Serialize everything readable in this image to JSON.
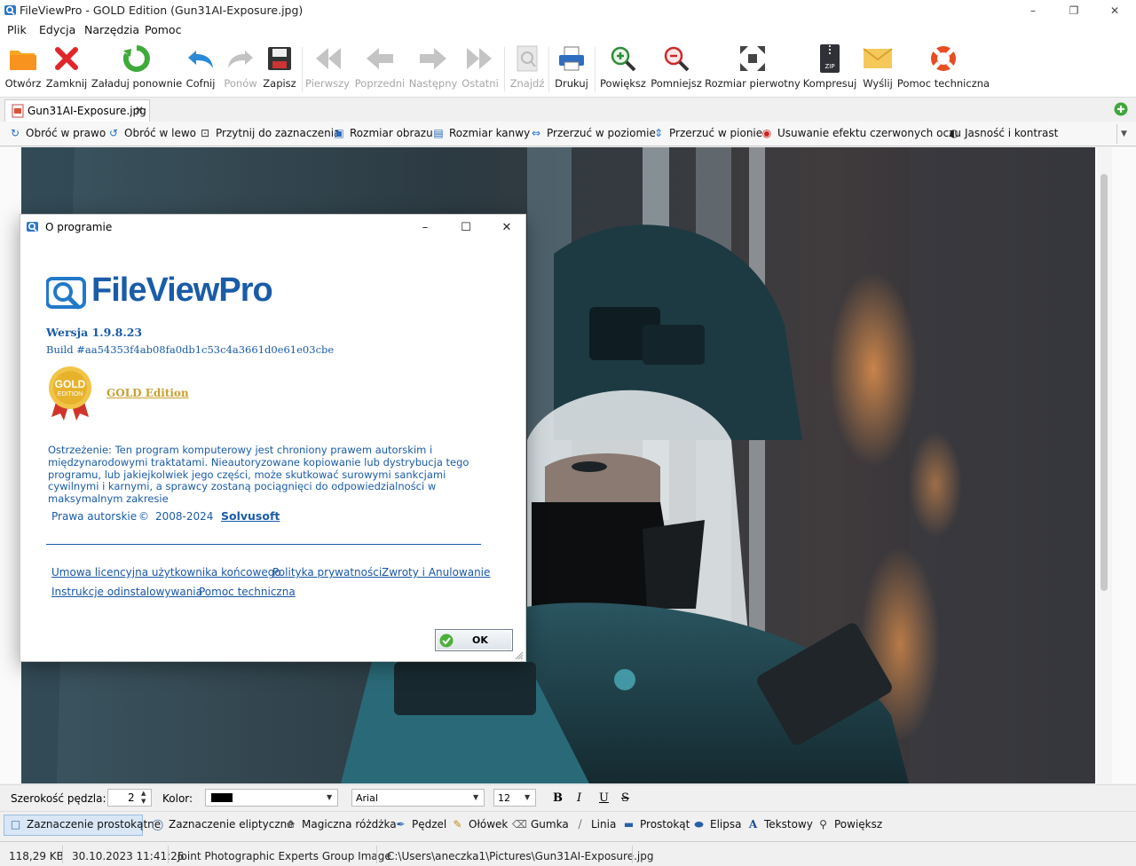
{
  "window": {
    "title": "FileViewPro - GOLD Edition (Gun31AI-Exposure.jpg)"
  },
  "menu": [
    "Plik",
    "Edycja",
    "Narzędzia",
    "Pomoc"
  ],
  "toolbar": [
    {
      "label": "Otwórz",
      "icon": "folder-open-icon",
      "enabled": true
    },
    {
      "label": "Zamknij",
      "icon": "close-x-icon",
      "enabled": true
    },
    {
      "label": "Załaduj ponownie",
      "icon": "reload-icon",
      "enabled": true
    },
    {
      "label": "Cofnij",
      "icon": "undo-icon",
      "enabled": true
    },
    {
      "label": "Ponów",
      "icon": "redo-icon",
      "enabled": false
    },
    {
      "label": "Zapisz",
      "icon": "save-icon",
      "enabled": true
    },
    {
      "label": "Pierwszy",
      "icon": "first-icon",
      "enabled": false
    },
    {
      "label": "Poprzedni",
      "icon": "previous-icon",
      "enabled": false
    },
    {
      "label": "Następny",
      "icon": "next-icon",
      "enabled": false
    },
    {
      "label": "Ostatni",
      "icon": "last-icon",
      "enabled": false
    },
    {
      "label": "Znajdź",
      "icon": "find-icon",
      "enabled": false
    },
    {
      "label": "Drukuj",
      "icon": "print-icon",
      "enabled": true
    },
    {
      "label": "Powiększ",
      "icon": "zoom-in-icon",
      "enabled": true
    },
    {
      "label": "Pomniejsz",
      "icon": "zoom-out-icon",
      "enabled": true
    },
    {
      "label": "Rozmiar pierwotny",
      "icon": "original-size-icon",
      "enabled": true
    },
    {
      "label": "Kompresuj",
      "icon": "zip-icon",
      "enabled": true
    },
    {
      "label": "Wyślij",
      "icon": "envelope-icon",
      "enabled": true
    },
    {
      "label": "Pomoc techniczna",
      "icon": "lifebuoy-icon",
      "enabled": true
    }
  ],
  "tabs": [
    {
      "label": "Gun31AI-Exposure.jpg",
      "active": true
    }
  ],
  "edit_toolbar": [
    "Obróć w prawo",
    "Obróć w lewo",
    "Przytnij do zaznaczenia",
    "Rozmiar obrazu",
    "Rozmiar kanwy",
    "Przerzuć w poziomie",
    "Przerzuć w pionie",
    "Usuwanie efektu czerwonych oczu",
    "Jasność i kontrast"
  ],
  "about_dialog": {
    "title": "O programie",
    "logo_text": "FileViewPro",
    "version": "Wersja 1.9.8.23",
    "build": "Build #aa54353f4ab08fa0db1c53c4a3661d0e61e03cbe",
    "badge_line1": "GOLD",
    "badge_line2": "EDITION",
    "edition_link": "GOLD Edition",
    "warning": "Ostrzeżenie: Ten program komputerowy jest chroniony prawem autorskim i międzynarodowymi traktatami. Nieautoryzowane kopiowanie lub dystrybucja tego programu, lub jakiejkolwiek jego części, może skutkować surowymi sankcjami cywilnymi i karnymi, a sprawcy zostaną pociągnięci do odpowiedzialności w maksymalnym zakresie",
    "copyright_label": "Prawa autorskie",
    "copyright_symbol": "©",
    "copyright_years": "2008-2024",
    "company_link": "Solvusoft",
    "links": [
      "Umowa licencyjna użytkownika końcowego",
      "Polityka prywatności",
      "Zwroty i Anulowanie",
      "Instrukcje odinstalowywania",
      "Pomoc techniczna"
    ],
    "ok_button": "OK",
    "accent_color": "#1a5ca8",
    "gold_color": "#c9a030"
  },
  "draw_options": {
    "brush_width_label": "Szerokość pędzla:",
    "brush_width_value": "2",
    "color_label": "Kolor:",
    "color_value": "#000000",
    "font_name": "Arial",
    "font_size": "12",
    "style_buttons": [
      "B",
      "I",
      "U",
      "S"
    ]
  },
  "draw_tools": [
    "Zaznaczenie prostokątne",
    "Zaznaczenie eliptyczne",
    "Magiczna różdżka",
    "Pędzel",
    "Ołówek",
    "Gumka",
    "Linia",
    "Prostokąt",
    "Elipsa",
    "Tekstowy",
    "Powiększ"
  ],
  "status": {
    "file_size": "118,29 KB",
    "date": "30.10.2023 11:41:26",
    "file_type": "Joint Photographic Experts Group Image",
    "path": "C:\\Users\\aneczka1\\Pictures\\Gun31AI-Exposure.jpg"
  }
}
